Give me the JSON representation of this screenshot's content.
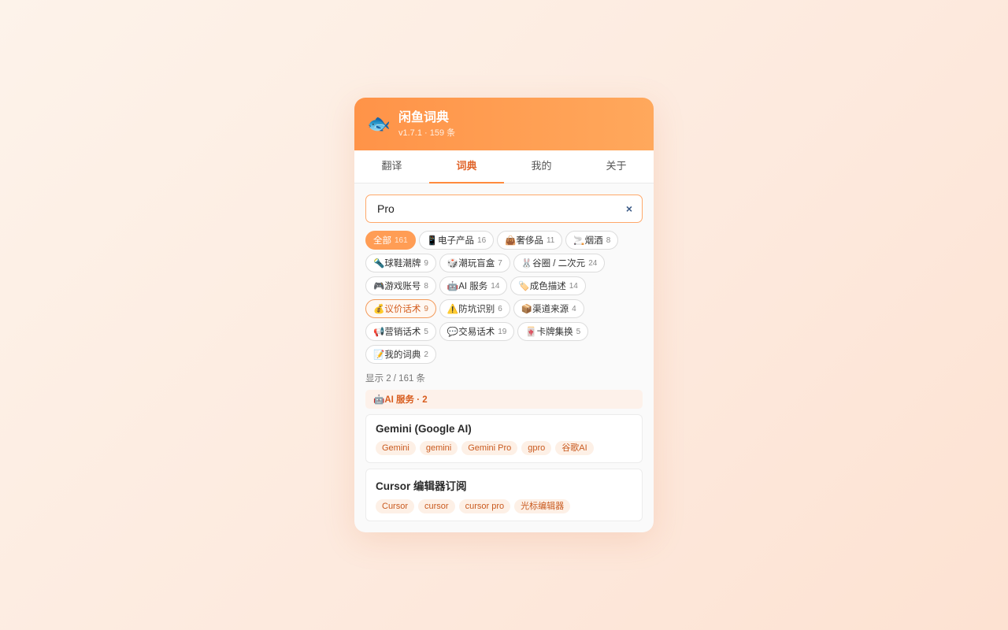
{
  "app": {
    "title": "闲鱼词典",
    "version_line": "v1.7.1 · 159 条",
    "logo": "🐟"
  },
  "tabs": [
    {
      "label": "翻译",
      "active": false
    },
    {
      "label": "词典",
      "active": true
    },
    {
      "label": "我的",
      "active": false
    },
    {
      "label": "关于",
      "active": false
    }
  ],
  "search": {
    "value": "Pro",
    "clear_icon": "×"
  },
  "categories": [
    {
      "label": "全部",
      "count": "161",
      "state": "all"
    },
    {
      "label": "📱电子产品",
      "count": "16"
    },
    {
      "label": "👜奢侈品",
      "count": "11"
    },
    {
      "label": "🚬烟酒",
      "count": "8"
    },
    {
      "label": "🔦球鞋潮牌",
      "count": "9"
    },
    {
      "label": "🎲潮玩盲盒",
      "count": "7"
    },
    {
      "label": "🐰谷圈 / 二次元",
      "count": "24"
    },
    {
      "label": "🎮游戏账号",
      "count": "8"
    },
    {
      "label": "🤖AI 服务",
      "count": "14"
    },
    {
      "label": "🏷️成色描述",
      "count": "14"
    },
    {
      "label": "💰议价话术",
      "count": "9",
      "state": "selected"
    },
    {
      "label": "⚠️防坑识别",
      "count": "6"
    },
    {
      "label": "📦渠道来源",
      "count": "4"
    },
    {
      "label": "📢营销话术",
      "count": "5"
    },
    {
      "label": "💬交易话术",
      "count": "19"
    },
    {
      "label": "🀄卡牌集换",
      "count": "5"
    },
    {
      "label": "📝我的词典",
      "count": "2"
    }
  ],
  "result_count": "显示 2 / 161 条",
  "group": {
    "label": "🤖AI 服务 · 2"
  },
  "results": [
    {
      "title": "Gemini (Google AI)",
      "tags": [
        "Gemini",
        "gemini",
        "Gemini Pro",
        "gpro",
        "谷歌AI"
      ]
    },
    {
      "title": "Cursor 编辑器订阅",
      "tags": [
        "Cursor",
        "cursor",
        "cursor pro",
        "光标编辑器"
      ]
    }
  ],
  "colors": {
    "accent": "#ff9348",
    "accent_text": "#e0642a",
    "tag_bg": "#fdf0e6"
  }
}
